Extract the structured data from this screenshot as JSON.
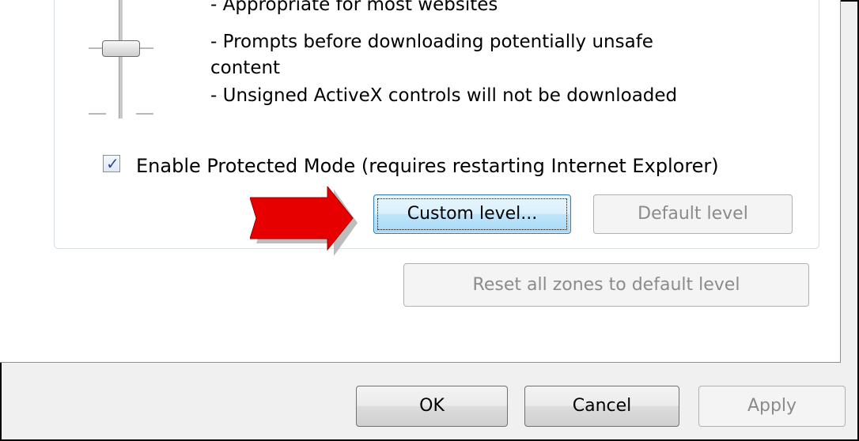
{
  "security_level": {
    "description_lines": [
      "- Appropriate for most websites",
      "- Prompts before downloading potentially unsafe",
      "content",
      "- Unsigned ActiveX controls will not be downloaded"
    ]
  },
  "protected_mode": {
    "label": "Enable Protected Mode (requires restarting Internet Explorer)",
    "checked": true
  },
  "buttons": {
    "custom_level": "Custom level...",
    "default_level": "Default level",
    "reset_all": "Reset all zones to default level",
    "ok": "OK",
    "cancel": "Cancel",
    "apply": "Apply"
  },
  "colors": {
    "arrow": "#e60000",
    "focus_border": "#3c7fb1"
  }
}
